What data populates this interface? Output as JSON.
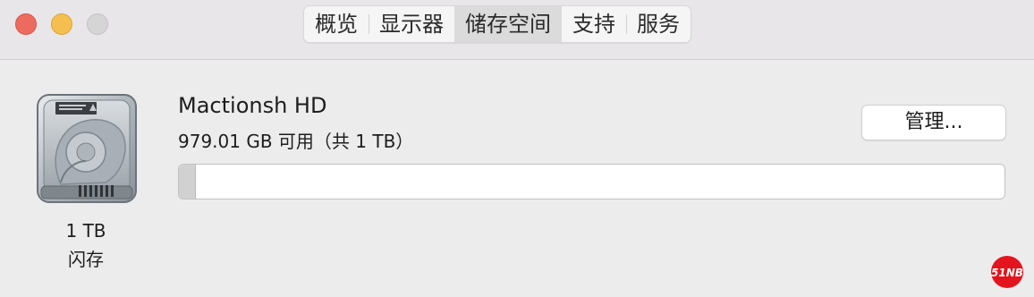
{
  "window": {
    "controls": [
      "close",
      "minimize",
      "zoom"
    ]
  },
  "tabs": [
    {
      "label": "概览",
      "active": false
    },
    {
      "label": "显示器",
      "active": false
    },
    {
      "label": "储存空间",
      "active": true
    },
    {
      "label": "支持",
      "active": false
    },
    {
      "label": "服务",
      "active": false
    }
  ],
  "disk": {
    "icon": "hard-drive-icon",
    "size_label": "1 TB",
    "type_label": "闪存",
    "name": "Mactionsh HD",
    "available_text": "979.01 GB 可用（共 1 TB）",
    "manage_label": "管理...",
    "used_fraction": 0.021
  },
  "watermark": {
    "text": "51NB"
  },
  "colors": {
    "close": "#ed6a5e",
    "minimize": "#f5bf4f",
    "zoom_inactive": "#d6d5d6",
    "selected_tab": "#dcdbdc",
    "used_storage": "#d1d1d1",
    "watermark": "#e3141d"
  }
}
